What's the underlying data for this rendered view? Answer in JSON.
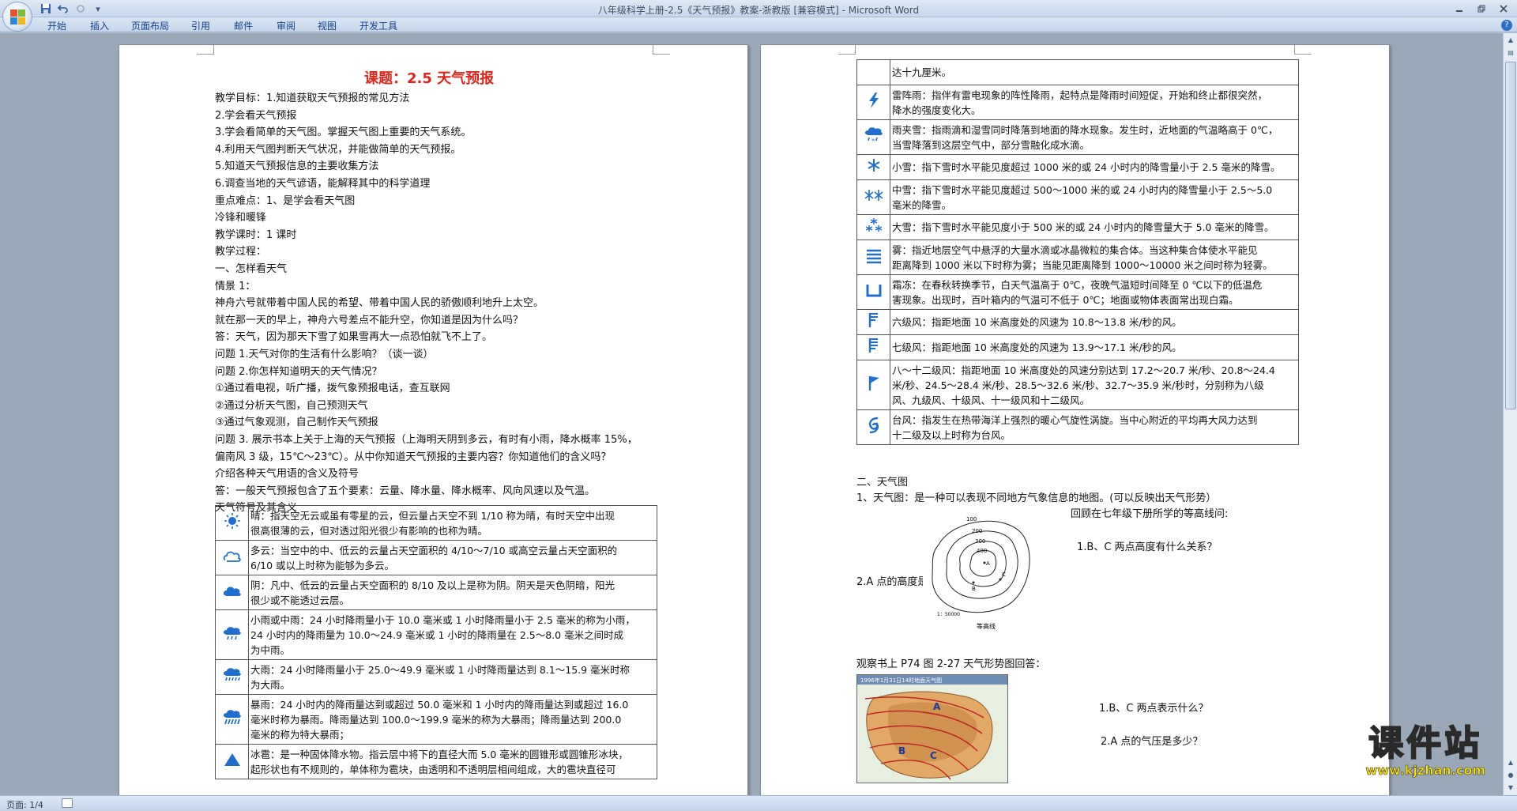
{
  "window": {
    "title": "八年级科学上册-2.5《天气预报》教案-浙教版 [兼容模式] - Microsoft Word"
  },
  "ribbon_tabs": [
    "开始",
    "插入",
    "页面布局",
    "引用",
    "邮件",
    "审阅",
    "视图",
    "开发工具"
  ],
  "icons": {
    "office": "office-logo-icon",
    "save": "save-icon",
    "undo": "undo-icon",
    "redo": "redo-icon",
    "customize": "qat-dropdown-icon",
    "help": "help-icon"
  },
  "left_page": {
    "title": "课题：2.5 天气预报",
    "lines": [
      "教学目标：1.知道获取天气预报的常见方法",
      "2.学会看天气预报",
      "3.学会看简单的天气图。掌握天气图上重要的天气系统。",
      "4.利用天气图判断天气状况，并能做简单的天气预报。",
      "5.知道天气预报信息的主要收集方法",
      "6.调查当地的天气谚语，能解释其中的科学道理",
      "重点难点：1、是学会看天气图",
      "冷锋和暖锋",
      "教学课时：1 课时",
      "教学过程：",
      "一、怎样看天气",
      "情景 1：",
      "        神舟六号就带着中国人民的希望、带着中国人民的骄傲顺利地升上太空。",
      "就在那一天的早上，神舟六号差点不能升空，你知道是因为什么吗？",
      "        答：天气，因为那天下雪了如果雪再大一点恐怕就飞不上了。",
      "问题 1.天气对你的生活有什么影响？（谈一谈）",
      "问题 2.你怎样知道明天的天气情况？",
      "      ①通过看电视，听广播，拨气象预报电话，查互联网",
      "②通过分析天气图，自己预测天气",
      "③通过气象观测，自己制作天气预报",
      "问题 3. 展示书本上关于上海的天气预报（上海明天阴到多云，有时有小雨，降水概率 15%，",
      "偏南风 3 级，15℃～23℃）。从中你知道天气预报的主要内容？你知道他们的含义吗？",
      "介绍各种天气用语的含义及符号",
      "答：一般天气预报包含了五个要素：云量、降水量、降水概率、风向风速以及气温。",
      "天气符号及其含义"
    ],
    "table": [
      {
        "icon": "sunny-icon",
        "lines": [
          "晴：指天空无云或虽有零星的云，但云量占天空不到 1/10 称为晴，有时天空中出现",
          "很高很薄的云，但对透过阳光很少有影响的也称为晴。"
        ]
      },
      {
        "icon": "cloudy-icon",
        "lines": [
          "多云：当空中的中、低云的云量占天空面积的 4/10～7/10 或高空云量占天空面积的",
          "6/10 或以上时称为能够为多云。"
        ]
      },
      {
        "icon": "overcast-icon",
        "lines": [
          "阴：凡中、低云的云量占天空面积的 8/10 及以上是称为阴。阴天是天色阴暗，阳光",
          "很少或不能透过云层。"
        ]
      },
      {
        "icon": "light-rain-icon",
        "lines": [
          "小雨或中雨：24 小时降雨量小于 10.0 毫米或 1 小时降雨量小于 2.5 毫米的称为小雨，",
          "24 小时内的降雨量为 10.0～24.9 毫米或 1 小时的降雨量在 2.5～8.0 毫米之间时成",
          "为中雨。"
        ]
      },
      {
        "icon": "heavy-rain-icon",
        "lines": [
          "大雨：24 小时降雨量小于 25.0～49.9 毫米或 1 小时降雨量达到 8.1～15.9 毫米时称",
          "为大雨。"
        ]
      },
      {
        "icon": "rainstorm-icon",
        "lines": [
          "暴雨：24 小时内的降雨量达到或超过 50.0 毫米和 1 小时内的降雨量达到或超过 16.0",
          "毫米时称为暴雨。降雨量达到 100.0～199.9 毫米的称为大暴雨；降雨量达到 200.0",
          "毫米的称为特大暴雨；"
        ]
      },
      {
        "icon": "hail-icon",
        "lines": [
          "冰雹：是一种固体降水物。指云层中将下的直径大而 5.0 毫米的圆锥形或圆锥形冰块，",
          "起形状也有不规则的，单体称为雹块，由透明和不透明层相间组成，大的雹块直径可"
        ]
      }
    ]
  },
  "right_page": {
    "table": [
      {
        "icon": "",
        "lines": [
          "达十九厘米。"
        ]
      },
      {
        "icon": "thunder-shower-icon",
        "lines": [
          "雷阵雨：指伴有雷电现象的阵性降雨，起特点是降雨时间短促，开始和终止都很突然，",
          "降水的强度变化大。"
        ]
      },
      {
        "icon": "sleet-icon",
        "lines": [
          "雨夹雪：指雨滴和湿雪同时降落到地面的降水现象。发生时，近地面的气温略高于 0℃，",
          "当雪降落到这层空气中，部分雪融化成水滴。"
        ]
      },
      {
        "icon": "light-snow-icon",
        "lines": [
          "小雪：指下雪时水平能见度超过 1000 米的或 24 小时内的降雪量小于 2.5 毫米的降雪。"
        ]
      },
      {
        "icon": "moderate-snow-icon",
        "lines": [
          "中雪：指下雪时水平能见度超过 500～1000 米的或 24 小时内的降雪量小于 2.5～5.0",
          "毫米的降雪。"
        ]
      },
      {
        "icon": "heavy-snow-icon",
        "lines": [
          "大雪：指下雪时水平能见度小于 500 米的或 24 小时内的降雪量大于 5.0 毫米的降雪。"
        ]
      },
      {
        "icon": "fog-icon",
        "lines": [
          "雾：指近地层空气中悬浮的大量水滴或冰晶微粒的集合体。当这种集合体使水平能见",
          "距离降到 1000 米以下时称为雾；当能见距离降到 1000～10000 米之间时称为轻雾。"
        ]
      },
      {
        "icon": "frost-icon",
        "lines": [
          "霜冻：在春秋转换季节，白天气温高于 0℃，夜晚气温短时间降至 0 ℃以下的低温危",
          "害现象。出现时，百叶箱内的气温可不低于 0℃；地面或物体表面常出现白霜。"
        ]
      },
      {
        "icon": "wind-force-6-icon",
        "lines": [
          "六级风：指距地面 10 米高度处的风速为 10.8～13.8 米/秒的风。"
        ]
      },
      {
        "icon": "wind-force-7-icon",
        "lines": [
          "七级风：指距地面 10 米高度处的风速为 13.9～17.1 米/秒的风。"
        ]
      },
      {
        "icon": "wind-force-8-12-icon",
        "lines": [
          "八～十二级风：指距地面 10 米高度处的风速分别达到 17.2～20.7 米/秒、20.8～24.4",
          "米/秒、24.5～28.4 米/秒、28.5～32.6 米/秒、32.7～35.9 米/秒时，分别称为八级",
          "风、九级风、十级风、十一级风和十二级风。"
        ]
      },
      {
        "icon": "typhoon-icon",
        "lines": [
          "台风：指发生在热带海洋上强烈的暖心气旋性涡旋。当中心附近的平均再大风力达到",
          "十二级及以上时称为台风。"
        ]
      }
    ],
    "section2": "二、天气图",
    "q1": "1、天气图：是一种可以表现不同地方气象信息的地图。(可以反映出天气形势）",
    "review": "回顾在七年级下册所学的等高线问:",
    "q_bc_height": "1.B、C 两点高度有什么关系？",
    "q_a_height": "2.A 点的高度是多少？",
    "contour_caption": "等高线",
    "contour_labels": [
      "100",
      "200",
      "300",
      "400",
      "A",
      "B",
      "C",
      "1：50000"
    ],
    "observe": "观察书上 P74 图 2-27 天气形势图回答：",
    "map_header": "1996年1月31日14时地面天气图",
    "q_bc_meaning": "1.B、C 两点表示什么？",
    "q_a_pressure": "2.A 点的气压是多少？"
  },
  "status": {
    "page": "页面: 1/4"
  },
  "watermark": {
    "text": "课件站",
    "url": "www.kjzhan.com"
  },
  "colors": {
    "title_red": "#e0241b",
    "icon_blue": "#1f6fd0",
    "ribbon_text": "#15428b"
  }
}
